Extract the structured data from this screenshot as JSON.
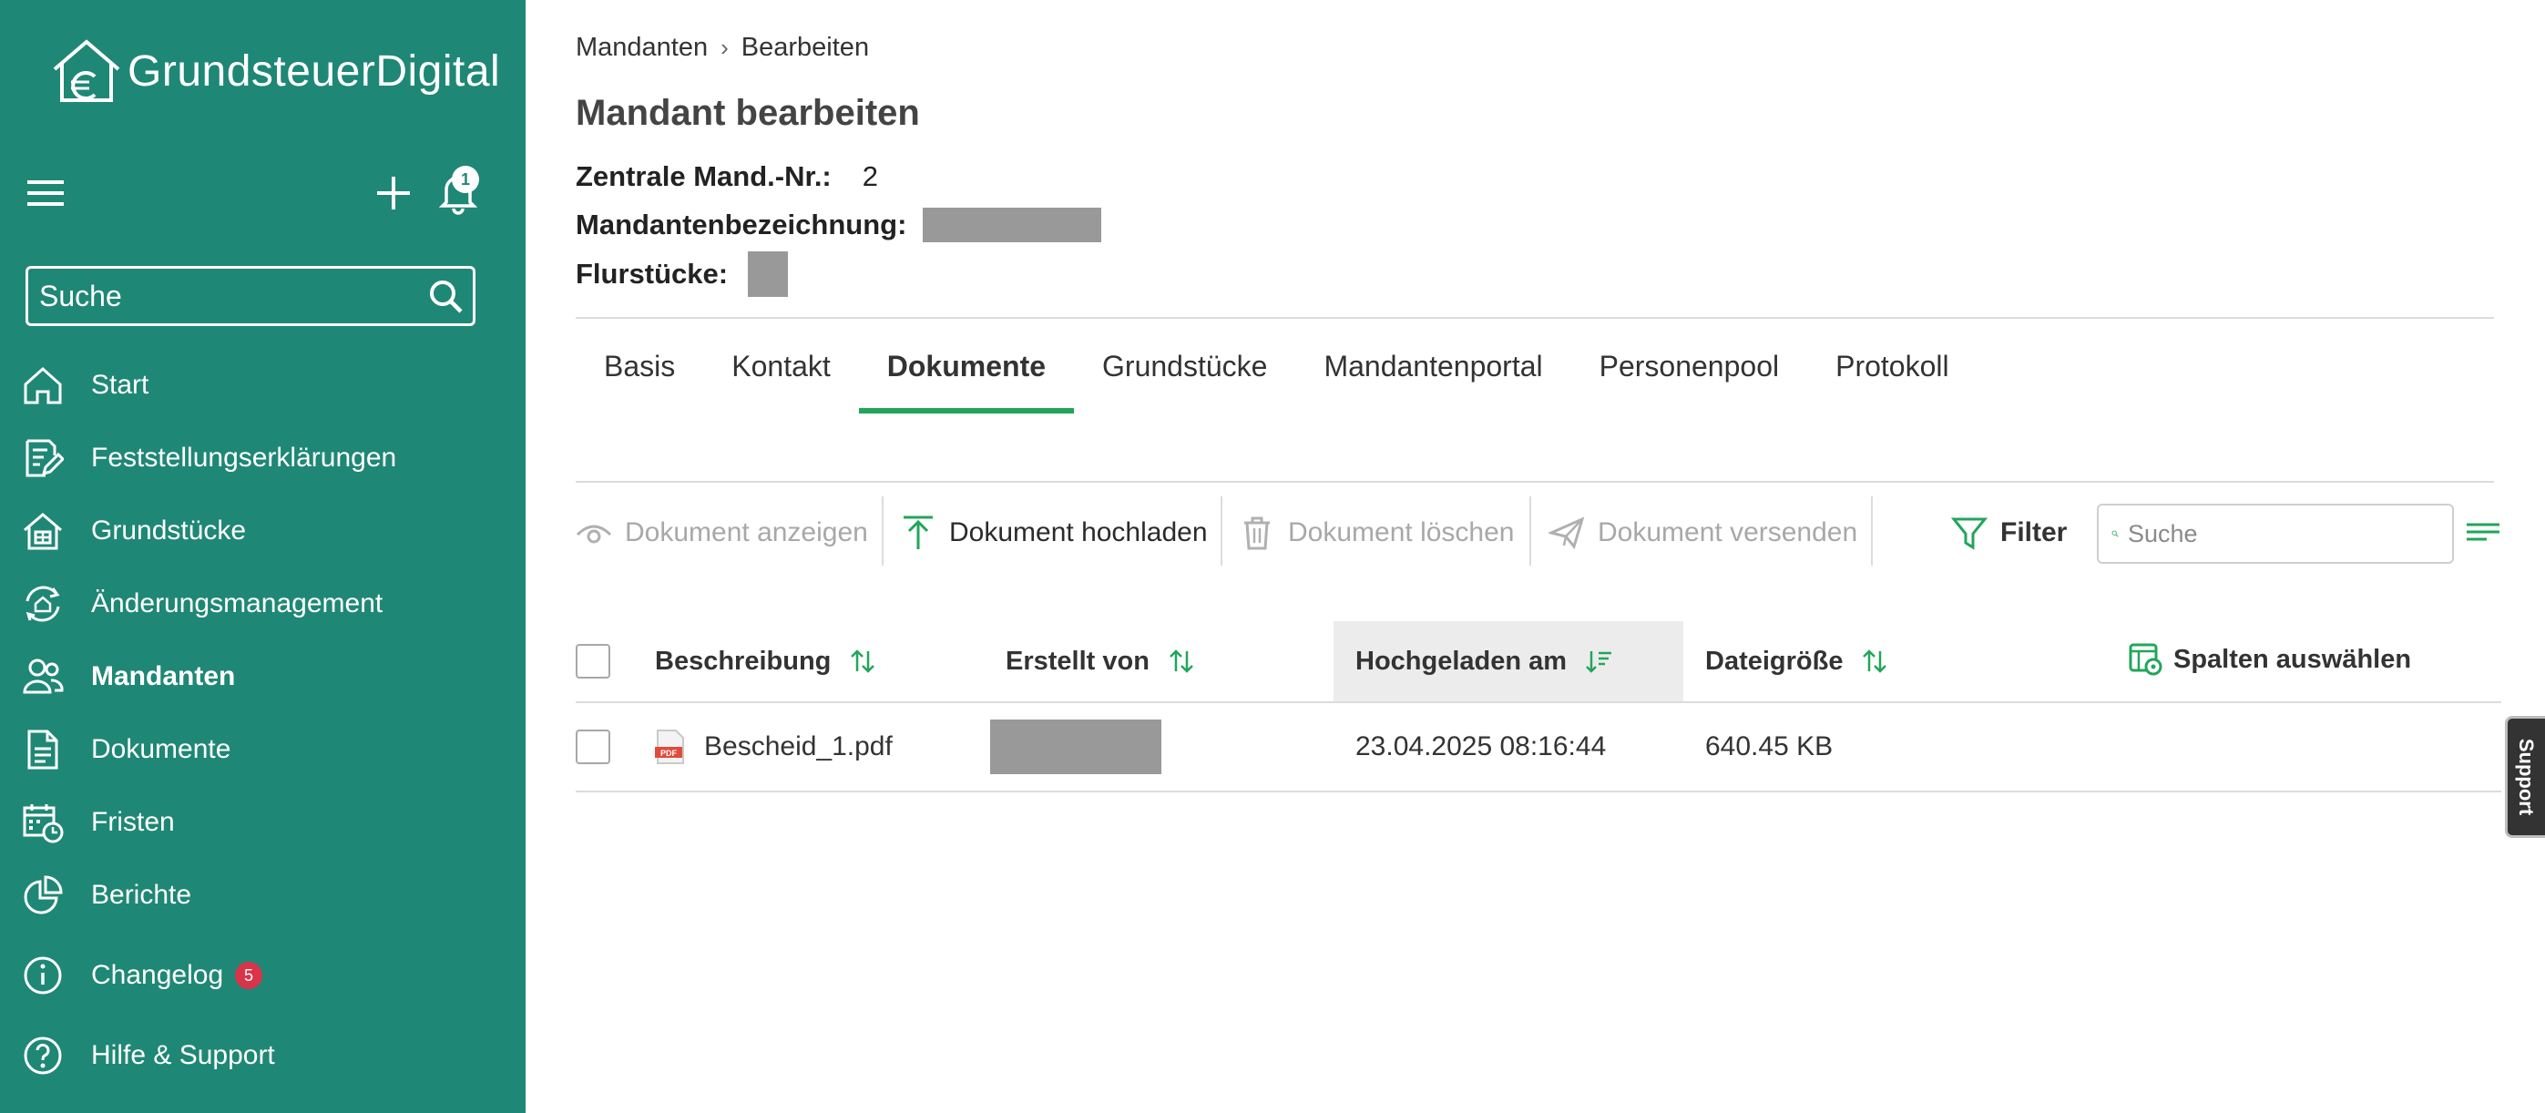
{
  "colors": {
    "sidebar_bg": "#1f8775",
    "accent_green": "#22a55a",
    "badge_red": "#d9344a"
  },
  "sidebar": {
    "logo_text": "GrundsteuerDigital",
    "notification_count": "1",
    "search_placeholder": "Suche",
    "items": [
      {
        "label": "Start",
        "icon": "home-icon"
      },
      {
        "label": "Feststellungserklärungen",
        "icon": "edit-document-icon"
      },
      {
        "label": "Grundstücke",
        "icon": "property-icon"
      },
      {
        "label": "Änderungsmanagement",
        "icon": "change-management-icon"
      },
      {
        "label": "Mandanten",
        "icon": "clients-icon",
        "active": true
      },
      {
        "label": "Dokumente",
        "icon": "document-icon"
      },
      {
        "label": "Fristen",
        "icon": "calendar-clock-icon"
      },
      {
        "label": "Berichte",
        "icon": "pie-chart-icon"
      },
      {
        "label": "Changelog",
        "icon": "info-icon",
        "badge": "5"
      },
      {
        "label": "Hilfe & Support",
        "icon": "help-icon"
      }
    ]
  },
  "breadcrumb": [
    "Mandanten",
    "Bearbeiten"
  ],
  "page_title": "Mandant bearbeiten",
  "info": {
    "mand_nr_label": "Zentrale Mand.-Nr.:",
    "mand_nr_value": "2",
    "bezeichnung_label": "Mandantenbezeichnung:",
    "flurstuecke_label": "Flurstücke:"
  },
  "tabs": [
    "Basis",
    "Kontakt",
    "Dokumente",
    "Grundstücke",
    "Mandantenportal",
    "Personenpool",
    "Protokoll"
  ],
  "active_tab": "Dokumente",
  "toolbar": {
    "view": "Dokument anzeigen",
    "upload": "Dokument hochladen",
    "delete": "Dokument löschen",
    "send": "Dokument versenden",
    "filter": "Filter",
    "search_placeholder": "Suche"
  },
  "table": {
    "columns": [
      "Beschreibung",
      "Erstellt von",
      "Hochgeladen am",
      "Dateigröße"
    ],
    "choose_columns": "Spalten auswählen",
    "rows": [
      {
        "beschreibung": "Bescheid_1.pdf",
        "hochgeladen_am": "23.04.2025 08:16:44",
        "dateigroesse": "640.45 KB"
      }
    ]
  },
  "support_label": "Support"
}
